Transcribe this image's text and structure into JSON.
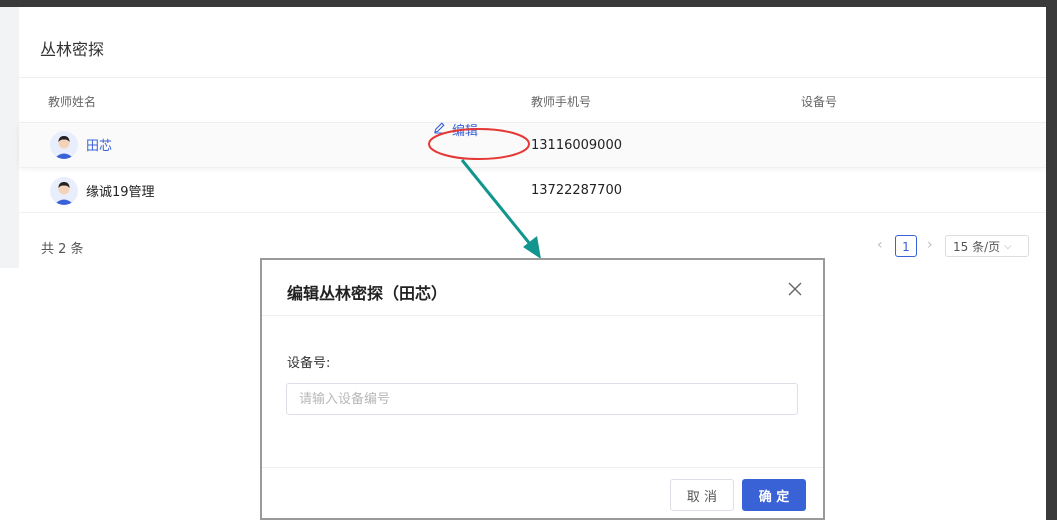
{
  "card": {
    "title": "丛林密探",
    "columns": [
      "教师姓名",
      "教师手机号",
      "设备号"
    ],
    "rows": [
      {
        "name": "田芯",
        "phone": "13116009000",
        "device": ""
      },
      {
        "name": "缘诚19管理",
        "phone": "13722287700",
        "device": ""
      }
    ],
    "edit_label": "编辑",
    "total": "共 2 条"
  },
  "pagination": {
    "prev_icon": "chevron-left-icon",
    "current_page": "1",
    "next_icon": "chevron-right-icon",
    "page_size": "15 条/页"
  },
  "modal": {
    "title": "编辑丛林密探（田芯）",
    "field_label": "设备号:",
    "field_placeholder": "请输入设备编号",
    "field_value": "",
    "cancel_label": "取 消",
    "confirm_label": "确 定"
  },
  "colors": {
    "accent": "#3a62d7",
    "annotation_circle": "#e53935",
    "annotation_arrow": "#13958f"
  }
}
